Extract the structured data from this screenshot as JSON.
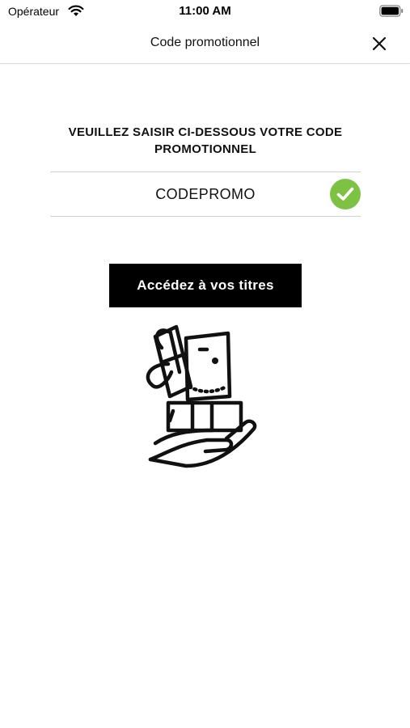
{
  "status_bar": {
    "carrier": "Opérateur",
    "time": "11:00 AM"
  },
  "nav": {
    "title": "Code promotionnel",
    "close_icon": "close-icon"
  },
  "promo": {
    "instruction": "VEUILLEZ SAISIR CI-DESSOUS VOTRE CODE PROMOTIONNEL",
    "code_value": "CODEPROMO",
    "status_icon": "check-circle-icon",
    "status_color": "#7dc242"
  },
  "actions": {
    "access_label": "Accédez à vos titres"
  },
  "illustration": {
    "icon": "gift-in-hand-illustration"
  },
  "colors": {
    "button_bg": "#000000",
    "button_text": "#ffffff",
    "success": "#7dc242"
  }
}
